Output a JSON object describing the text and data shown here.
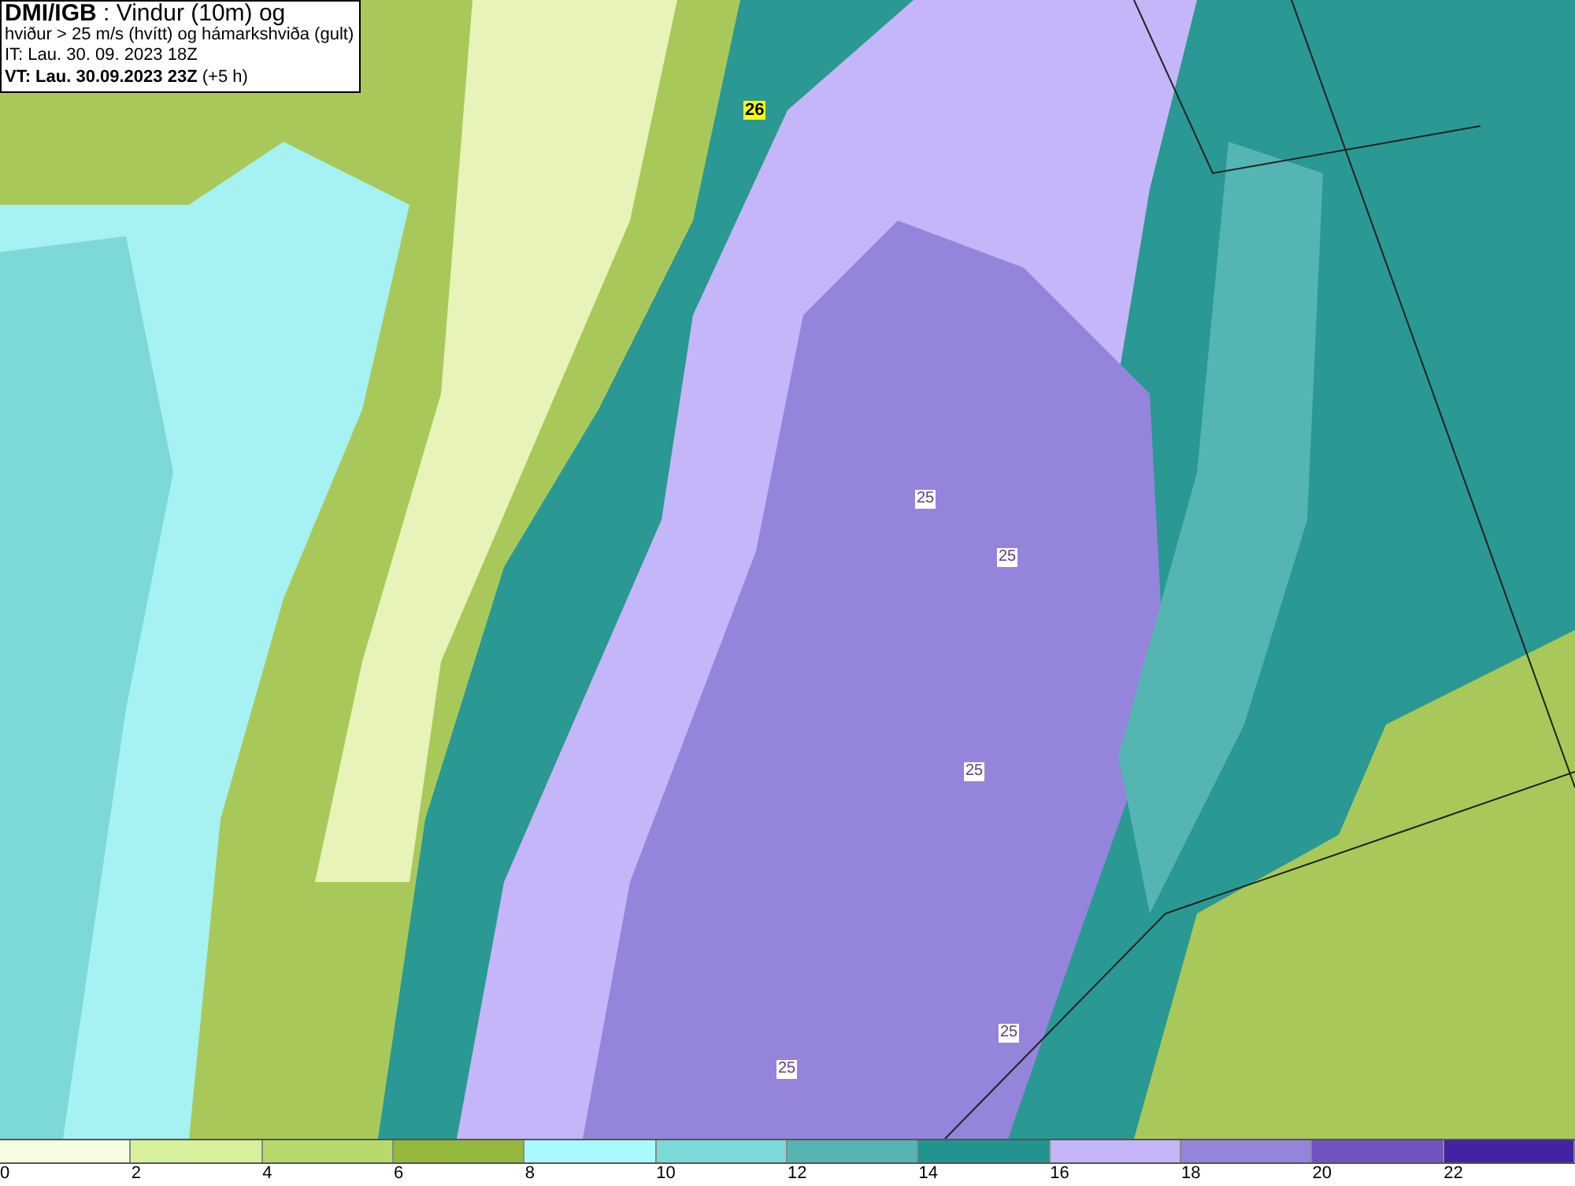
{
  "title_box": {
    "lines": [
      "**DMI/IGB** : Vindur (10m) og",
      "hviður > 25 m/s (hvítt) og hámarkshviða (gult)",
      "IT: Lau. 30. 09. 2023 18Z",
      "**VT: Lau. 30.09.2023 23Z** (+5 h)"
    ]
  },
  "map": {
    "labels": [
      {
        "text": "26",
        "kind": "max"
      },
      {
        "text": "25",
        "kind": "gust"
      },
      {
        "text": "25",
        "kind": "gust"
      },
      {
        "text": "25",
        "kind": "gust"
      },
      {
        "text": "25",
        "kind": "gust"
      },
      {
        "text": "25",
        "kind": "gust"
      }
    ]
  },
  "legend": {
    "cells": [
      {
        "color": "#f7fbe0"
      },
      {
        "color": "#d8ef9c"
      },
      {
        "color": "#b5d96b"
      },
      {
        "color": "#94b83c"
      },
      {
        "color": "#aaf9fc"
      },
      {
        "color": "#7dd8d8"
      },
      {
        "color": "#54b5b2"
      },
      {
        "color": "#23938f"
      },
      {
        "color": "#c4b6f8"
      },
      {
        "color": "#9584dc"
      },
      {
        "color": "#6f53c0"
      },
      {
        "color": "#4223a4"
      }
    ],
    "ticks": [
      "0",
      "2",
      "4",
      "6",
      "8",
      "10",
      "12",
      "14",
      "16",
      "18",
      "20",
      "22"
    ]
  }
}
